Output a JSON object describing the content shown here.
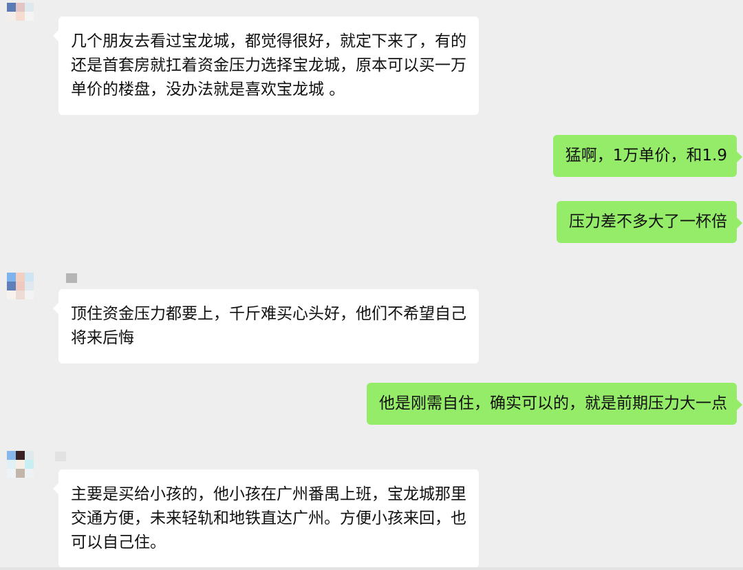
{
  "messages": [
    {
      "side": "in",
      "lines": [
        "几个朋友去看过宝龙城，都觉得很好，就定下来了，有的",
        "还是首套房就扛着资金压力选择宝龙城，原本可以买一万",
        "单价的楼盘，没办法就是喜欢宝龙城 。"
      ]
    },
    {
      "side": "out",
      "lines": [
        "猛啊，1万单价，和1.9"
      ]
    },
    {
      "side": "out",
      "lines": [
        "压力差不多大了一杯倍"
      ]
    },
    {
      "side": "in",
      "lines": [
        "顶住资金压力都要上，千斤难买心头好，他们不希望自己",
        "将来后悔"
      ]
    },
    {
      "side": "out",
      "lines": [
        "他是刚需自住，确实可以的，就是前期压力大一点"
      ]
    },
    {
      "side": "in",
      "lines": [
        "主要是买给小孩的，他小孩在广州番禺上班，宝龙城那里",
        "交通方便，未来轻轨和地铁直达广州。方便小孩来回，也",
        "可以自己住。"
      ]
    }
  ],
  "colors": {
    "background": "#eeeeee",
    "incoming_bubble": "#ffffff",
    "outgoing_bubble": "#95ec69",
    "text": "#111111"
  }
}
